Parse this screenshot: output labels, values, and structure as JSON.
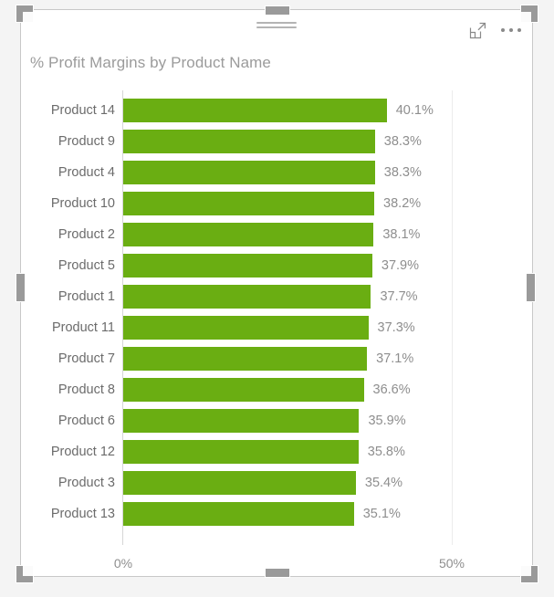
{
  "visual": {
    "title": "% Profit Margins by Product Name",
    "drag_handle_name": "drag-handle",
    "icons": {
      "focus_mode": "focus-mode-icon",
      "more_options": "more-options-icon"
    }
  },
  "chart_data": {
    "type": "bar",
    "orientation": "horizontal",
    "title": "% Profit Margins by Product Name",
    "xlabel": "",
    "ylabel": "",
    "categories": [
      "Product 14",
      "Product 9",
      "Product 4",
      "Product 10",
      "Product 2",
      "Product 5",
      "Product 1",
      "Product 11",
      "Product 7",
      "Product 8",
      "Product 6",
      "Product 12",
      "Product 3",
      "Product 13"
    ],
    "values": [
      40.1,
      38.3,
      38.3,
      38.2,
      38.1,
      37.9,
      37.7,
      37.3,
      37.1,
      36.6,
      35.9,
      35.8,
      35.4,
      35.1
    ],
    "data_labels": [
      "40.1%",
      "38.3%",
      "38.3%",
      "38.2%",
      "38.1%",
      "37.9%",
      "37.7%",
      "37.3%",
      "37.1%",
      "36.6%",
      "35.9%",
      "35.8%",
      "35.4%",
      "35.1%"
    ],
    "xlim": [
      0,
      50
    ],
    "x_ticks": [
      0,
      50
    ],
    "x_tick_labels": [
      "0%",
      "50%"
    ],
    "grid": true,
    "legend": "none",
    "bar_color": "#6aae12",
    "label_color": "#8e8e8e",
    "category_color": "#6b6b6b"
  }
}
